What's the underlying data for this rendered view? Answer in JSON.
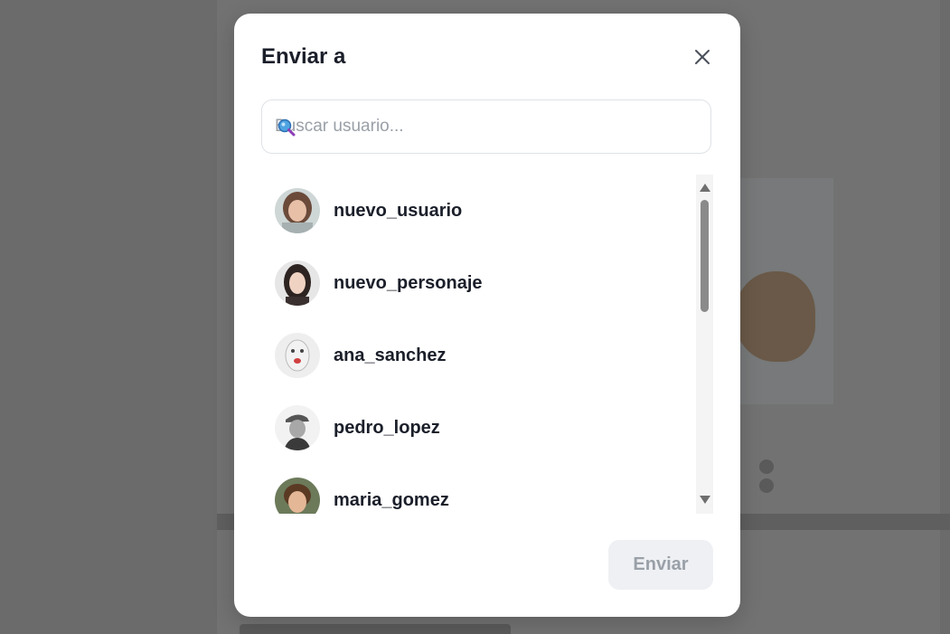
{
  "modal": {
    "title": "Enviar a",
    "close_icon": "close-icon",
    "search": {
      "placeholder": "Buscar usuario...",
      "value": "",
      "icon": "search-icon"
    },
    "users": [
      {
        "username": "nuevo_usuario",
        "avatar_color": "#b78f7a"
      },
      {
        "username": "nuevo_personaje",
        "avatar_color": "#5a4a46"
      },
      {
        "username": "ana_sanchez",
        "avatar_color": "#dcdcdc"
      },
      {
        "username": "pedro_lopez",
        "avatar_color": "#8c8c8c"
      },
      {
        "username": "maria_gomez",
        "avatar_color": "#9a6b4b"
      }
    ],
    "send_button": {
      "label": "Enviar",
      "disabled": true
    }
  },
  "colors": {
    "overlay": "#6b6b6b",
    "modal_bg": "#ffffff",
    "title_text": "#1b1f2a",
    "button_disabled_bg": "#eef0f3",
    "button_disabled_text": "#9aa0a8"
  }
}
